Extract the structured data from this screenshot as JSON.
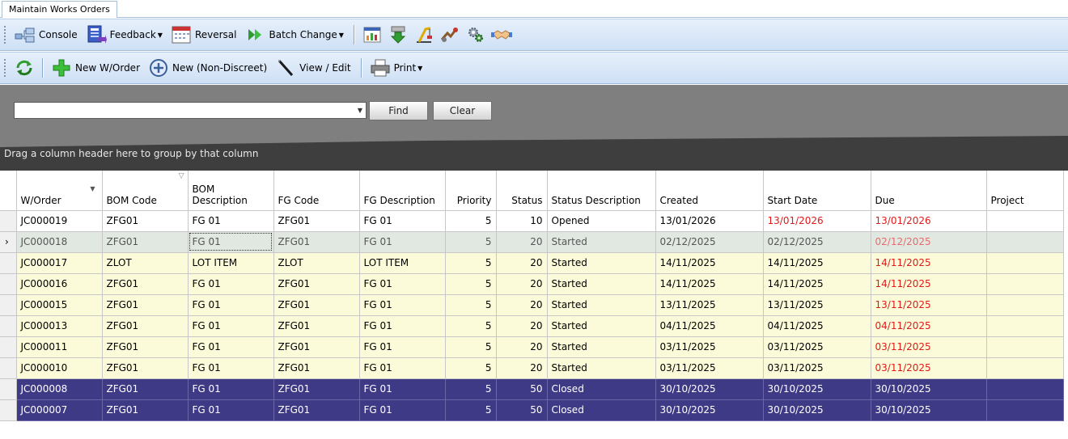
{
  "tab": {
    "label": "Maintain Works Orders"
  },
  "toolbar1": {
    "console": "Console",
    "feedback": "Feedback",
    "reversal": "Reversal",
    "batch_change": "Batch Change"
  },
  "toolbar2": {
    "new_worder": "New W/Order",
    "new_non_discreet": "New (Non-Discreet)",
    "view_edit": "View / Edit",
    "print": "Print"
  },
  "search": {
    "value": "",
    "find": "Find",
    "clear": "Clear"
  },
  "group_panel": {
    "hint": "Drag a column header here to group by that column"
  },
  "columns": {
    "worder": "W/Order",
    "bom_code": "BOM Code",
    "bom_desc": "BOM Description",
    "fg_code": "FG Code",
    "fg_desc": "FG Description",
    "priority": "Priority",
    "status": "Status",
    "status_desc": "Status Description",
    "created": "Created",
    "start_date": "Start Date",
    "due": "Due",
    "project": "Project"
  },
  "rows": [
    {
      "worder": "JC000019",
      "bom_code": "ZFG01",
      "bom_desc": "FG 01",
      "fg_code": "ZFG01",
      "fg_desc": "FG 01",
      "priority": "5",
      "status": "10",
      "status_desc": "Opened",
      "created": "13/01/2026",
      "start_date": "13/01/2026",
      "due": "13/01/2026",
      "project": ""
    },
    {
      "worder": "JC000018",
      "bom_code": "ZFG01",
      "bom_desc": "FG 01",
      "fg_code": "ZFG01",
      "fg_desc": "FG 01",
      "priority": "5",
      "status": "20",
      "status_desc": "Started",
      "created": "02/12/2025",
      "start_date": "02/12/2025",
      "due": "02/12/2025",
      "project": ""
    },
    {
      "worder": "JC000017",
      "bom_code": "ZLOT",
      "bom_desc": "LOT ITEM",
      "fg_code": "ZLOT",
      "fg_desc": "LOT ITEM",
      "priority": "5",
      "status": "20",
      "status_desc": "Started",
      "created": "14/11/2025",
      "start_date": "14/11/2025",
      "due": "14/11/2025",
      "project": ""
    },
    {
      "worder": "JC000016",
      "bom_code": "ZFG01",
      "bom_desc": "FG 01",
      "fg_code": "ZFG01",
      "fg_desc": "FG 01",
      "priority": "5",
      "status": "20",
      "status_desc": "Started",
      "created": "14/11/2025",
      "start_date": "14/11/2025",
      "due": "14/11/2025",
      "project": ""
    },
    {
      "worder": "JC000015",
      "bom_code": "ZFG01",
      "bom_desc": "FG 01",
      "fg_code": "ZFG01",
      "fg_desc": "FG 01",
      "priority": "5",
      "status": "20",
      "status_desc": "Started",
      "created": "13/11/2025",
      "start_date": "13/11/2025",
      "due": "13/11/2025",
      "project": ""
    },
    {
      "worder": "JC000013",
      "bom_code": "ZFG01",
      "bom_desc": "FG 01",
      "fg_code": "ZFG01",
      "fg_desc": "FG 01",
      "priority": "5",
      "status": "20",
      "status_desc": "Started",
      "created": "04/11/2025",
      "start_date": "04/11/2025",
      "due": "04/11/2025",
      "project": ""
    },
    {
      "worder": "JC000011",
      "bom_code": "ZFG01",
      "bom_desc": "FG 01",
      "fg_code": "ZFG01",
      "fg_desc": "FG 01",
      "priority": "5",
      "status": "20",
      "status_desc": "Started",
      "created": "03/11/2025",
      "start_date": "03/11/2025",
      "due": "03/11/2025",
      "project": ""
    },
    {
      "worder": "JC000010",
      "bom_code": "ZFG01",
      "bom_desc": "FG 01",
      "fg_code": "ZFG01",
      "fg_desc": "FG 01",
      "priority": "5",
      "status": "20",
      "status_desc": "Started",
      "created": "03/11/2025",
      "start_date": "03/11/2025",
      "due": "03/11/2025",
      "project": ""
    },
    {
      "worder": "JC000008",
      "bom_code": "ZFG01",
      "bom_desc": "FG 01",
      "fg_code": "ZFG01",
      "fg_desc": "FG 01",
      "priority": "5",
      "status": "50",
      "status_desc": "Closed",
      "created": "30/10/2025",
      "start_date": "30/10/2025",
      "due": "30/10/2025",
      "project": ""
    },
    {
      "worder": "JC000007",
      "bom_code": "ZFG01",
      "bom_desc": "FG 01",
      "fg_code": "ZFG01",
      "fg_desc": "FG 01",
      "priority": "5",
      "status": "50",
      "status_desc": "Closed",
      "created": "30/10/2025",
      "start_date": "30/10/2025",
      "due": "30/10/2025",
      "project": ""
    }
  ],
  "icons": {
    "toolbar1": [
      "console-icon",
      "feedback-icon",
      "reversal-calendar-icon",
      "batch-change-arrow-icon",
      "report-grid-icon",
      "download-arrow-icon",
      "crane-icon",
      "machine-tool-icon",
      "gears-icon",
      "handshake-icon"
    ],
    "toolbar2": [
      "refresh-icon",
      "plus-icon",
      "new-circle-icon",
      "pen-icon",
      "printer-icon"
    ]
  },
  "colors": {
    "opened_row": "#ffffff",
    "started_row": "#fbfbd9",
    "closed_row": "#3f3a86",
    "overdue_text": "#e11919"
  }
}
